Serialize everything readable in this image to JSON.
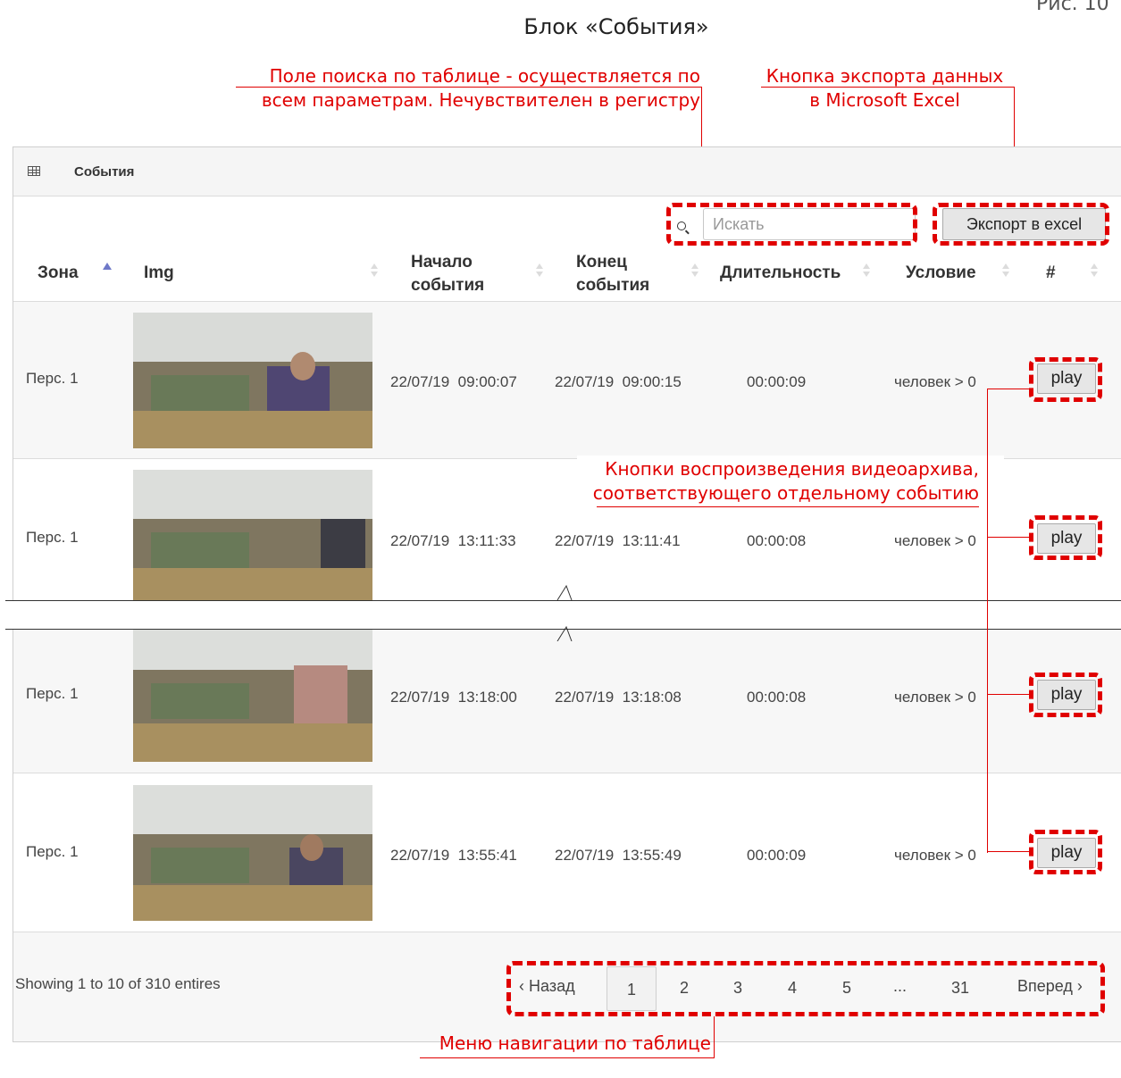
{
  "figure": {
    "title": "Блок «События»",
    "corner_text": "Рис. 10"
  },
  "annotations": {
    "search": [
      "Поле поиска по таблице - осуществляется по",
      "всем параметрам. Нечувствителен в регистру"
    ],
    "export": [
      "Кнопка экспорта данных",
      "в Microsoft Excel"
    ],
    "play": [
      "Кнопки воспроизведения видеоархива,",
      "соответствующего отдельному событию"
    ],
    "nav": "Меню навигации по таблице"
  },
  "panel": {
    "title": "События",
    "icon": "table-grid-icon",
    "search_placeholder": "Искать",
    "export_label": "Экспорт в excel"
  },
  "table": {
    "columns": [
      {
        "label": "Зона",
        "sorted": "asc"
      },
      {
        "label": "Img"
      },
      {
        "label": "Начало события"
      },
      {
        "label": "Конец события"
      },
      {
        "label": "Длительность"
      },
      {
        "label": "Условие"
      },
      {
        "label": "#"
      }
    ],
    "rows": [
      {
        "zone": "Перс. 1",
        "start": "22/07/19  09:00:07",
        "end": "22/07/19  09:00:15",
        "duration": "00:00:09",
        "condition": "человек > 0",
        "action": "play"
      },
      {
        "zone": "Перс. 1",
        "start": "22/07/19  13:11:33",
        "end": "22/07/19  13:11:41",
        "duration": "00:00:08",
        "condition": "человек > 0",
        "action": "play"
      },
      {
        "zone": "Перс. 1",
        "start": "22/07/19  13:18:00",
        "end": "22/07/19  13:18:08",
        "duration": "00:00:08",
        "condition": "человек > 0",
        "action": "play"
      },
      {
        "zone": "Перс. 1",
        "start": "22/07/19  13:55:41",
        "end": "22/07/19  13:55:49",
        "duration": "00:00:09",
        "condition": "человек > 0",
        "action": "play"
      }
    ]
  },
  "footer": {
    "info": "Showing 1 to 10 of 310 entires",
    "prev_label": "Назад",
    "next_label": "Вперед",
    "pages": [
      "1",
      "2",
      "3",
      "4",
      "5",
      "...",
      "31"
    ],
    "active_page": "1"
  },
  "colors": {
    "annotation": "#e00000",
    "sort_active": "#6e78c8"
  }
}
